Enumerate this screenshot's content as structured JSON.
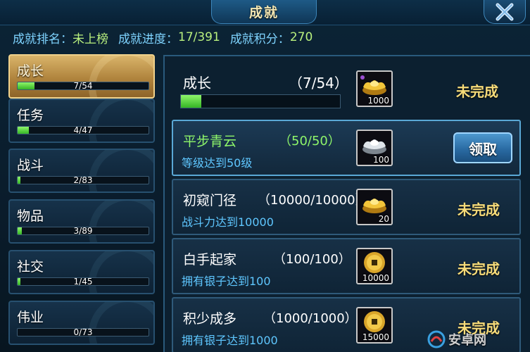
{
  "window": {
    "title": "成就"
  },
  "stats": {
    "rank_label": "成就排名：",
    "rank_value": "未上榜",
    "progress_label": "成就进度：",
    "progress_value": "17/391",
    "points_label": "成就积分：",
    "points_value": "270"
  },
  "categories": [
    {
      "name": "成长",
      "progress": "7/54",
      "fraction": 0.13,
      "active": true
    },
    {
      "name": "任务",
      "progress": "4/47",
      "fraction": 0.085
    },
    {
      "name": "战斗",
      "progress": "2/83",
      "fraction": 0.024
    },
    {
      "name": "物品",
      "progress": "3/89",
      "fraction": 0.034
    },
    {
      "name": "社交",
      "progress": "1/45",
      "fraction": 0.022
    },
    {
      "name": "伟业",
      "progress": "0/73",
      "fraction": 0.0
    }
  ],
  "summary": {
    "name": "成长",
    "progress": "（7/54）",
    "fraction": 0.13,
    "reward": {
      "icon": "gold-ingot-icon",
      "amount": "1000"
    },
    "status": "未完成"
  },
  "achievements": [
    {
      "name": "平步青云",
      "progress": "（50/50）",
      "desc": "等级达到50级",
      "reward": {
        "icon": "silver-ingot-icon",
        "amount": "100"
      },
      "claim_label": "领取",
      "done": true
    },
    {
      "name": "初窥门径",
      "progress": "（10000/10000）",
      "desc": "战斗力达到10000",
      "reward": {
        "icon": "gold-ingot-icon",
        "amount": "20"
      },
      "status": "未完成"
    },
    {
      "name": "白手起家",
      "progress": "（100/100）",
      "desc": "拥有银子达到100",
      "reward": {
        "icon": "copper-coin-icon",
        "amount": "10000"
      },
      "status": "未完成"
    },
    {
      "name": "积少成多",
      "progress": "（1000/1000）",
      "desc": "拥有银子达到1000",
      "reward": {
        "icon": "copper-coin-icon",
        "amount": "15000"
      },
      "status": "未完成"
    }
  ],
  "watermark": {
    "text": "安卓网"
  },
  "colors": {
    "accent_green": "#8ef56a",
    "status_gold": "#f7dc7a",
    "desc_blue": "#5fc7ff"
  }
}
